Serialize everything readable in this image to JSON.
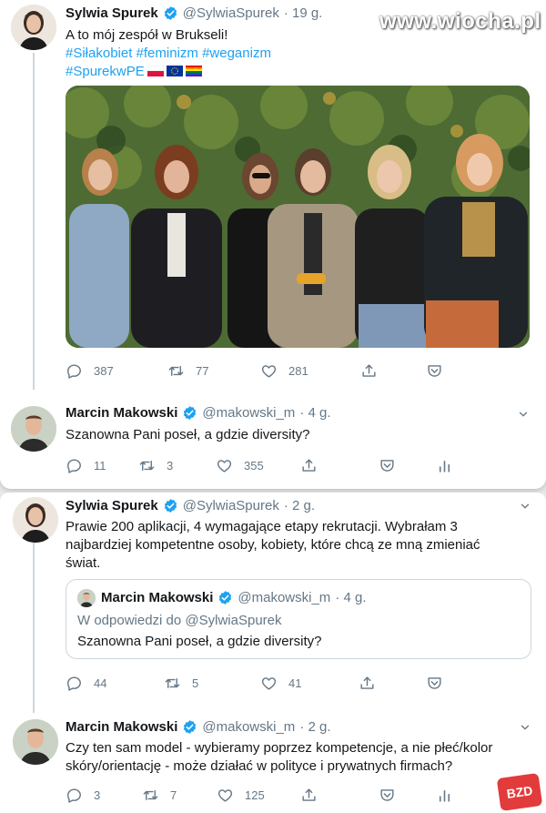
{
  "watermark": "www.wiocha.pl",
  "logo_badge": "BZD",
  "tweets": [
    {
      "name": "Sylwia Spurek",
      "handle": "@SylwiaSpurek",
      "time": "· 19 g.",
      "text": "A to mój zespół w Brukseli!",
      "hashtags_line1": "#Siłakobiet #feminizm #weganizm",
      "hashtags_line2": "#SpurekwPE",
      "flags": [
        "pl-flag",
        "eu-flag",
        "rainbow-flag"
      ],
      "replies": "387",
      "retweets": "77",
      "likes": "281"
    },
    {
      "name": "Marcin Makowski",
      "handle": "@makowski_m",
      "time": "· 4 g.",
      "text": "Szanowna Pani poseł, a gdzie diversity?",
      "replies": "11",
      "retweets": "3",
      "likes": "355"
    },
    {
      "name": "Sylwia Spurek",
      "handle": "@SylwiaSpurek",
      "time": "· 2 g.",
      "text_lines": [
        "Prawie 200 aplikacji, 4 wymagające etapy rekrutacji. Wybrałam 3",
        "najbardziej kompetentne osoby, kobiety, które chcą ze mną zmieniać",
        "świat."
      ],
      "quote": {
        "name": "Marcin Makowski",
        "handle": "@makowski_m",
        "time": "· 4 g.",
        "reply_to": "W odpowiedzi do @SylwiaSpurek",
        "text": "Szanowna Pani poseł, a gdzie diversity?"
      },
      "replies": "44",
      "retweets": "5",
      "likes": "41"
    },
    {
      "name": "Marcin Makowski",
      "handle": "@makowski_m",
      "time": "· 2 g.",
      "text_lines": [
        "Czy ten sam model - wybieramy poprzez kompetencje, a nie płeć/kolor",
        "skóry/orientację - może działać w polityce i prywatnych firmach?"
      ],
      "replies": "3",
      "retweets": "7",
      "likes": "125"
    }
  ],
  "colors": {
    "link": "#1da1f2",
    "secondary": "#657786",
    "verified": "#1da1f2",
    "divider": "#ccd6dd"
  }
}
